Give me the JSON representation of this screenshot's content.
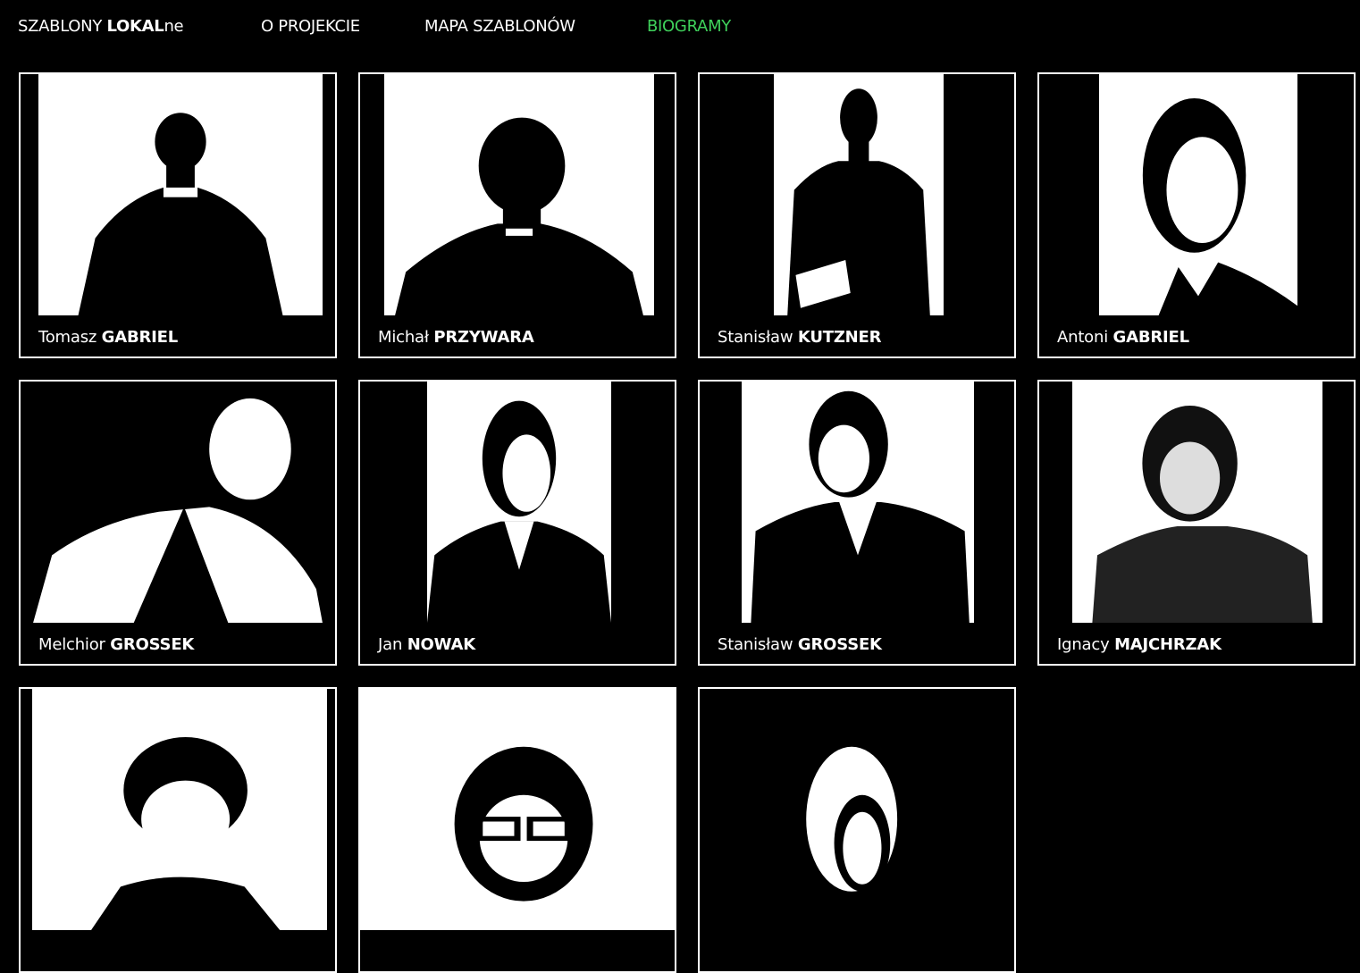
{
  "nav": {
    "logo_regular": "SZABLONY ",
    "logo_bold": "LOKAL",
    "logo_suffix": "ne",
    "links": [
      {
        "label": "O PROJEKCIE"
      },
      {
        "label": "MAPA SZABLONÓW"
      },
      {
        "label": "BIOGRAMY"
      }
    ],
    "active_color": "#3fd15b"
  },
  "people": [
    {
      "first": "Tomasz",
      "last": "GABRIEL",
      "icon": "portrait-priest"
    },
    {
      "first": "Michał",
      "last": "PRZYWARA",
      "icon": "portrait-priest"
    },
    {
      "first": "Stanisław",
      "last": "KUTZNER",
      "icon": "portrait-seated-man"
    },
    {
      "first": "Antoni",
      "last": "GABRIEL",
      "icon": "portrait-man-suit"
    },
    {
      "first": "Melchior",
      "last": "GROSSEK",
      "icon": "portrait-older-man"
    },
    {
      "first": "Jan",
      "last": "NOWAK",
      "icon": "portrait-man-suit"
    },
    {
      "first": "Stanisław",
      "last": "GROSSEK",
      "icon": "portrait-man-suit"
    },
    {
      "first": "Ignacy",
      "last": "MAJCHRZAK",
      "icon": "portrait-man-suit"
    },
    {
      "icon": "portrait-young-man"
    },
    {
      "icon": "portrait-woman-glasses"
    },
    {
      "icon": "portrait-woman"
    }
  ]
}
